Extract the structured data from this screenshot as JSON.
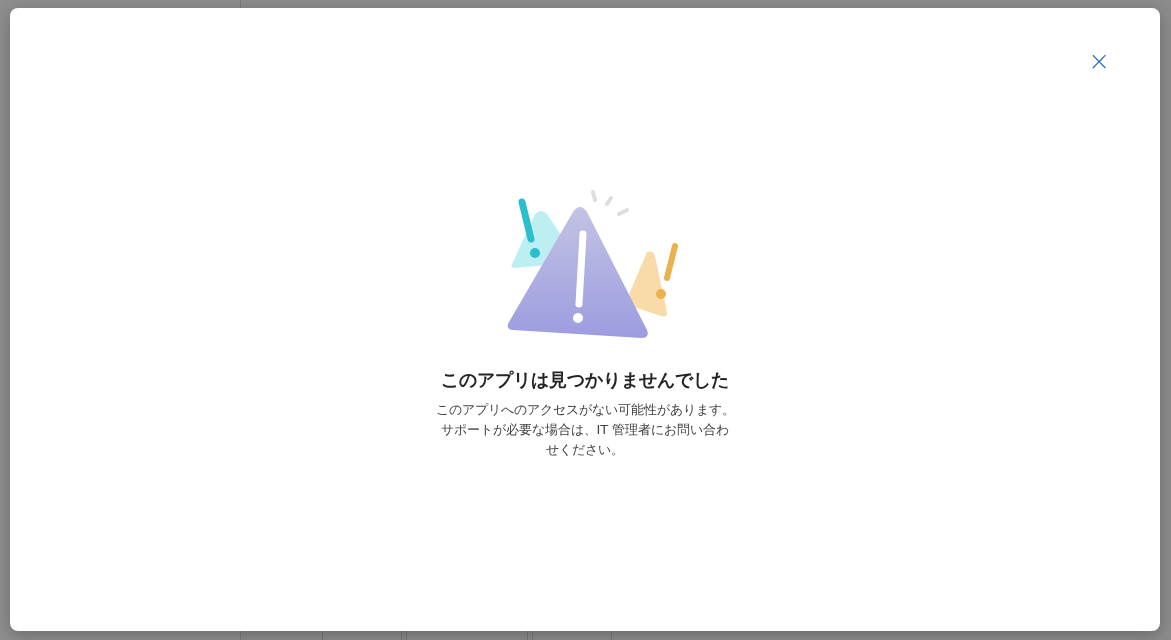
{
  "dialog": {
    "close": "×",
    "title": "このアプリは見つかりませんでした",
    "message": "このアプリへのアクセスがない可能性があります。サポートが必要な場合は、IT 管理者にお問い合わせください。"
  }
}
